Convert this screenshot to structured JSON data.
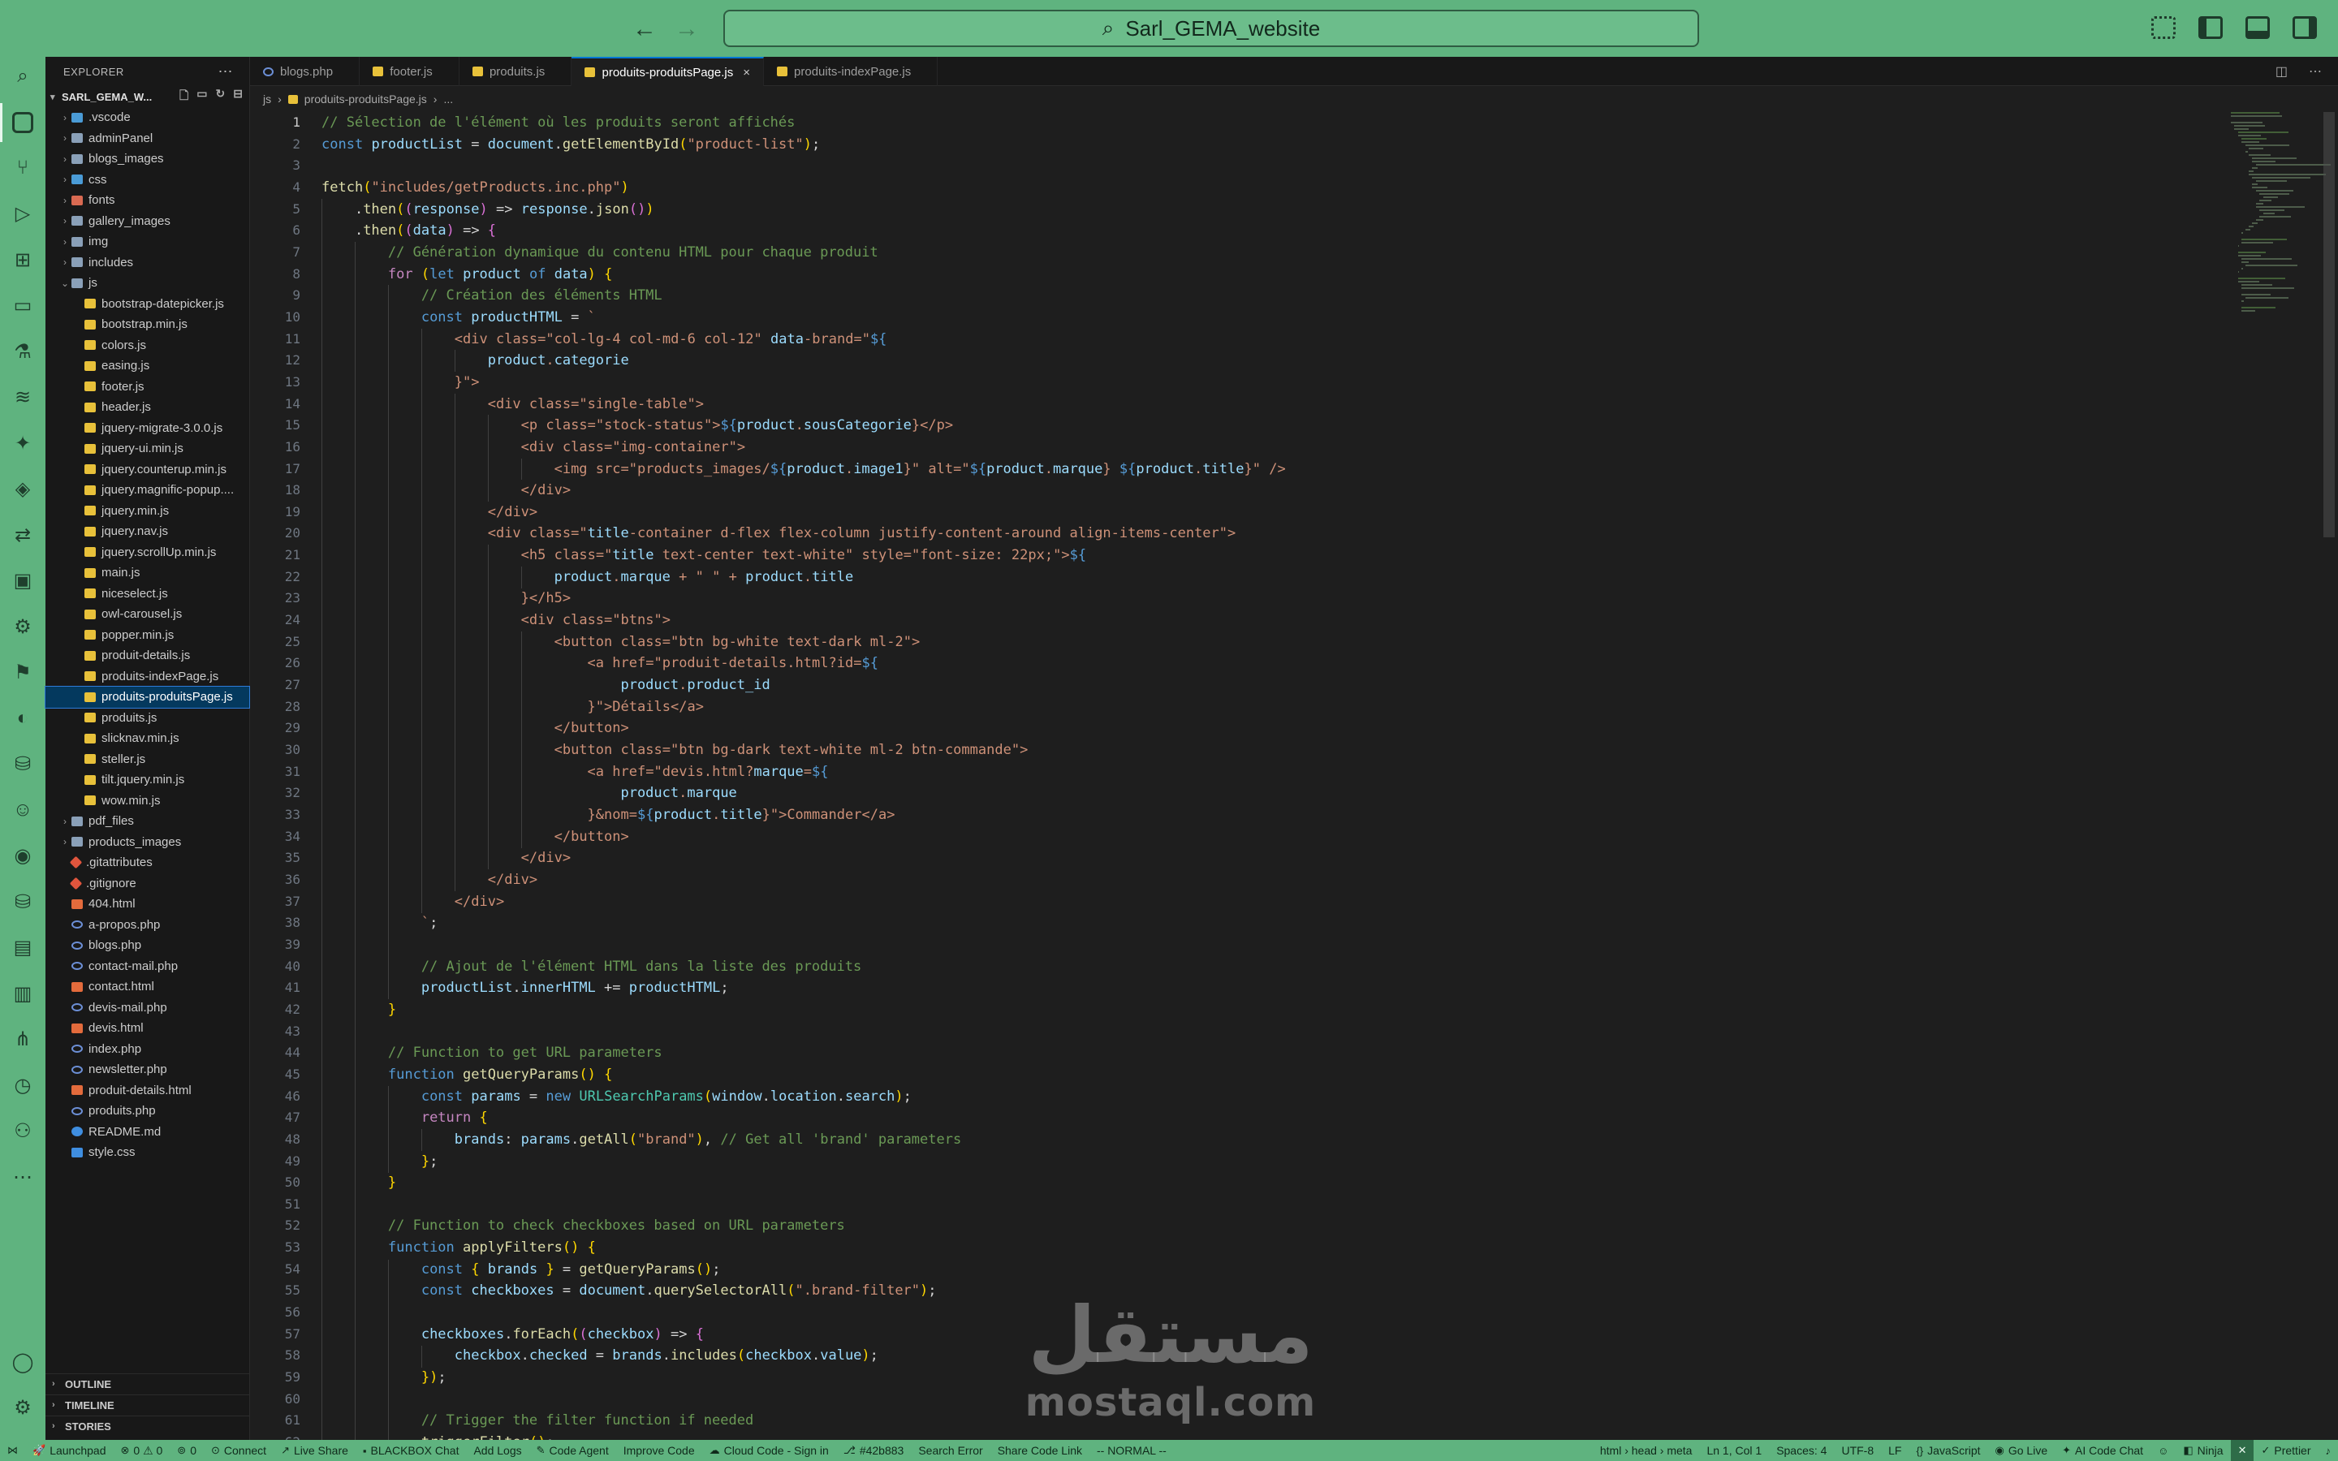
{
  "window": {
    "search_text": "Sarl_GEMA_website",
    "icons": [
      "back-arrow-icon",
      "forward-arrow-icon",
      "search-icon",
      "layout-icon"
    ]
  },
  "activity_bar": {
    "items": [
      "explorer-icon",
      "search-icon",
      "source-control-icon",
      "run-debug-icon",
      "extensions-icon",
      "remote-explorer-icon",
      "testing-icon",
      "docker-whale-icon",
      "ai-sparkle-icon",
      "python-icon",
      "live-share-icon",
      "container-icon",
      "settings-gear-icon",
      "flag-icon",
      "edge-icon",
      "database-tools-icon",
      "copilot-icon",
      "github-icon",
      "database-icon",
      "terminal-icon",
      "notebook-icon",
      "git-graph-icon",
      "timeline-icon",
      "tree-icon",
      "more-icon"
    ],
    "bottom": [
      "account-icon",
      "manage-gear-icon"
    ]
  },
  "sidebar": {
    "title": "EXPLORER",
    "workspace": "SARL_GEMA_W...",
    "tree": [
      {
        "label": ".vscode",
        "type": "folder-blue",
        "depth": 0,
        "expanded": false
      },
      {
        "label": "adminPanel",
        "type": "folder",
        "depth": 0,
        "expanded": false
      },
      {
        "label": "blogs_images",
        "type": "folder",
        "depth": 0,
        "expanded": false
      },
      {
        "label": "css",
        "type": "folder-blue",
        "depth": 0,
        "expanded": false
      },
      {
        "label": "fonts",
        "type": "folder-red",
        "depth": 0,
        "expanded": false
      },
      {
        "label": "gallery_images",
        "type": "folder",
        "depth": 0,
        "expanded": false
      },
      {
        "label": "img",
        "type": "folder",
        "depth": 0,
        "expanded": false
      },
      {
        "label": "includes",
        "type": "folder",
        "depth": 0,
        "expanded": false
      },
      {
        "label": "js",
        "type": "folder",
        "depth": 0,
        "expanded": true
      },
      {
        "label": "bootstrap-datepicker.js",
        "type": "js",
        "depth": 1
      },
      {
        "label": "bootstrap.min.js",
        "type": "js",
        "depth": 1
      },
      {
        "label": "colors.js",
        "type": "js",
        "depth": 1
      },
      {
        "label": "easing.js",
        "type": "js",
        "depth": 1
      },
      {
        "label": "footer.js",
        "type": "js",
        "depth": 1
      },
      {
        "label": "header.js",
        "type": "js",
        "depth": 1
      },
      {
        "label": "jquery-migrate-3.0.0.js",
        "type": "js",
        "depth": 1
      },
      {
        "label": "jquery-ui.min.js",
        "type": "js",
        "depth": 1
      },
      {
        "label": "jquery.counterup.min.js",
        "type": "js",
        "depth": 1
      },
      {
        "label": "jquery.magnific-popup....",
        "type": "js",
        "depth": 1
      },
      {
        "label": "jquery.min.js",
        "type": "js",
        "depth": 1
      },
      {
        "label": "jquery.nav.js",
        "type": "js",
        "depth": 1
      },
      {
        "label": "jquery.scrollUp.min.js",
        "type": "js",
        "depth": 1
      },
      {
        "label": "main.js",
        "type": "js",
        "depth": 1
      },
      {
        "label": "niceselect.js",
        "type": "js",
        "depth": 1
      },
      {
        "label": "owl-carousel.js",
        "type": "js",
        "depth": 1
      },
      {
        "label": "popper.min.js",
        "type": "js",
        "depth": 1
      },
      {
        "label": "produit-details.js",
        "type": "js",
        "depth": 1
      },
      {
        "label": "produits-indexPage.js",
        "type": "js",
        "depth": 1
      },
      {
        "label": "produits-produitsPage.js",
        "type": "js",
        "depth": 1,
        "selected": true
      },
      {
        "label": "produits.js",
        "type": "js",
        "depth": 1
      },
      {
        "label": "slicknav.min.js",
        "type": "js",
        "depth": 1
      },
      {
        "label": "steller.js",
        "type": "js",
        "depth": 1
      },
      {
        "label": "tilt.jquery.min.js",
        "type": "js",
        "depth": 1
      },
      {
        "label": "wow.min.js",
        "type": "js",
        "depth": 1
      },
      {
        "label": "pdf_files",
        "type": "folder",
        "depth": 0,
        "expanded": false
      },
      {
        "label": "products_images",
        "type": "folder",
        "depth": 0,
        "expanded": false
      },
      {
        "label": ".gitattributes",
        "type": "git",
        "depth": 0
      },
      {
        "label": ".gitignore",
        "type": "git",
        "depth": 0
      },
      {
        "label": "404.html",
        "type": "html",
        "depth": 0
      },
      {
        "label": "a-propos.php",
        "type": "php",
        "depth": 0
      },
      {
        "label": "blogs.php",
        "type": "php",
        "depth": 0
      },
      {
        "label": "contact-mail.php",
        "type": "php",
        "depth": 0
      },
      {
        "label": "contact.html",
        "type": "html",
        "depth": 0
      },
      {
        "label": "devis-mail.php",
        "type": "php",
        "depth": 0
      },
      {
        "label": "devis.html",
        "type": "html",
        "depth": 0
      },
      {
        "label": "index.php",
        "type": "php",
        "depth": 0
      },
      {
        "label": "newsletter.php",
        "type": "php",
        "depth": 0
      },
      {
        "label": "produit-details.html",
        "type": "html",
        "depth": 0
      },
      {
        "label": "produits.php",
        "type": "php",
        "depth": 0
      },
      {
        "label": "README.md",
        "type": "md",
        "depth": 0
      },
      {
        "label": "style.css",
        "type": "css",
        "depth": 0
      }
    ],
    "sections": [
      "OUTLINE",
      "TIMELINE",
      "STORIES"
    ]
  },
  "tabs": [
    {
      "label": "blogs.php",
      "type": "php"
    },
    {
      "label": "footer.js",
      "type": "js"
    },
    {
      "label": "produits.js",
      "type": "js"
    },
    {
      "label": "produits-produitsPage.js",
      "type": "js",
      "active": true
    },
    {
      "label": "produits-indexPage.js",
      "type": "js"
    }
  ],
  "breadcrumb": [
    "js",
    "produits-produitsPage.js",
    "..."
  ],
  "editor": {
    "current_line": 1,
    "lines": [
      "// Sélection de l'élément où les produits seront affichés",
      "const productList = document.getElementById(\"product-list\");",
      "",
      "fetch(\"includes/getProducts.inc.php\")",
      "    .then((response) => response.json())",
      "    .then((data) => {",
      "        // Génération dynamique du contenu HTML pour chaque produit",
      "        for (let product of data) {",
      "            // Création des éléments HTML",
      "            const productHTML = `",
      "                <div class=\"col-lg-4 col-md-6 col-12\" data-brand=\"${",
      "                    product.categorie",
      "                }\">",
      "                    <div class=\"single-table\">",
      "                        <p class=\"stock-status\">${product.sousCategorie}</p>",
      "                        <div class=\"img-container\">",
      "                            <img src=\"products_images/${product.image1}\" alt=\"${product.marque} ${product.title}\" />",
      "                        </div>",
      "                    </div>",
      "                    <div class=\"title-container d-flex flex-column justify-content-around align-items-center\">",
      "                        <h5 class=\"title text-center text-white\" style=\"font-size: 22px;\">${",
      "                            product.marque + \" \" + product.title",
      "                        }</h5>",
      "                        <div class=\"btns\">",
      "                            <button class=\"btn bg-white text-dark ml-2\">",
      "                                <a href=\"produit-details.html?id=${",
      "                                    product.product_id",
      "                                }\">Détails</a>",
      "                            </button>",
      "                            <button class=\"btn bg-dark text-white ml-2 btn-commande\">",
      "                                <a href=\"devis.html?marque=${",
      "                                    product.marque",
      "                                }&nom=${product.title}\">Commander</a>",
      "                            </button>",
      "                        </div>",
      "                    </div>",
      "                </div>",
      "            `;",
      "",
      "            // Ajout de l'élément HTML dans la liste des produits",
      "            productList.innerHTML += productHTML;",
      "        }",
      "",
      "        // Function to get URL parameters",
      "        function getQueryParams() {",
      "            const params = new URLSearchParams(window.location.search);",
      "            return {",
      "                brands: params.getAll(\"brand\"), // Get all 'brand' parameters",
      "            };",
      "        }",
      "",
      "        // Function to check checkboxes based on URL parameters",
      "        function applyFilters() {",
      "            const { brands } = getQueryParams();",
      "            const checkboxes = document.querySelectorAll(\".brand-filter\");",
      "",
      "            checkboxes.forEach((checkbox) => {",
      "                checkbox.checked = brands.includes(checkbox.value);",
      "            });",
      "",
      "            // Trigger the filter function if needed",
      "            triggerFilter();"
    ]
  },
  "watermark": {
    "arabic": "مستقل",
    "latin": "mostaql.com"
  },
  "statusbar": {
    "left": [
      {
        "icon": "remote-icon",
        "label": ""
      },
      {
        "icon": "rocket-icon",
        "label": "Launchpad"
      },
      {
        "icon": "error-icon",
        "label": "0 ⚠ 0"
      },
      {
        "icon": "ports-icon",
        "label": "0"
      },
      {
        "icon": "connect-icon",
        "label": "Connect"
      },
      {
        "icon": "live-share-icon",
        "label": "Live Share"
      },
      {
        "icon": "blackbox-icon",
        "label": "BLACKBOX Chat"
      },
      {
        "icon": "",
        "label": "Add Logs"
      },
      {
        "icon": "agent-icon",
        "label": "Code Agent"
      },
      {
        "icon": "",
        "label": "Improve Code"
      },
      {
        "icon": "cloud-icon",
        "label": "Cloud Code - Sign in"
      },
      {
        "icon": "commit-icon",
        "label": "#42b883"
      },
      {
        "icon": "",
        "label": "Search Error"
      },
      {
        "icon": "",
        "label": "Share Code Link"
      },
      {
        "icon": "",
        "label": "-- NORMAL --"
      }
    ],
    "right": [
      {
        "icon": "",
        "label": "html › head › meta"
      },
      {
        "icon": "",
        "label": "Ln 1, Col 1"
      },
      {
        "icon": "",
        "label": "Spaces: 4"
      },
      {
        "icon": "",
        "label": "UTF-8"
      },
      {
        "icon": "",
        "label": "LF"
      },
      {
        "icon": "braces-icon",
        "label": "JavaScript"
      },
      {
        "icon": "broadcast-icon",
        "label": "Go Live"
      },
      {
        "icon": "ai-icon",
        "label": "AI Code Chat"
      },
      {
        "icon": "feedback-icon",
        "label": ""
      },
      {
        "icon": "ninja-icon",
        "label": "Ninja"
      },
      {
        "icon": "bell-slash-icon",
        "label": ""
      },
      {
        "icon": "check-icon",
        "label": "Prettier"
      },
      {
        "icon": "bell-icon",
        "label": ""
      }
    ]
  },
  "colors": {
    "accent_green": "#5fb37f",
    "editor_bg": "#1e1e1e",
    "sidebar_bg": "#181818",
    "selection": "#04395e"
  }
}
